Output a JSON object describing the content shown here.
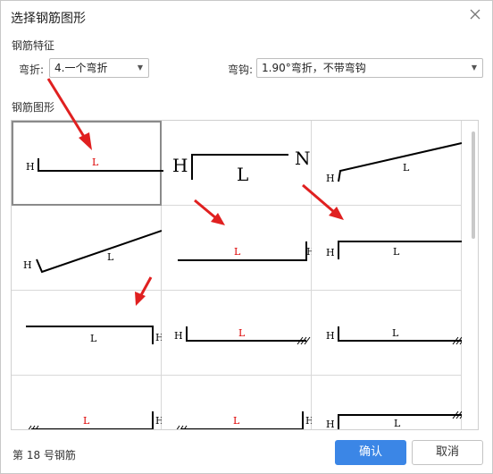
{
  "title": "选择钢筋图形",
  "section_features": "钢筋特征",
  "bend": {
    "label": "弯折:",
    "value": "4.一个弯折"
  },
  "hook": {
    "label": "弯钩:",
    "value": "1.90°弯折，不带弯钩"
  },
  "section_shapes": "钢筋图形",
  "shape_text": {
    "H": "H",
    "L": "L",
    "N": "N"
  },
  "status": "第 18 号钢筋",
  "buttons": {
    "ok": "确认",
    "cancel": "取消"
  },
  "colors": {
    "accent": "#3b86e6",
    "annotation": "#e02020",
    "label_red": "#d00000"
  },
  "icons": [
    "close-icon",
    "chevron-down-icon",
    "red-arrow-icon"
  ]
}
